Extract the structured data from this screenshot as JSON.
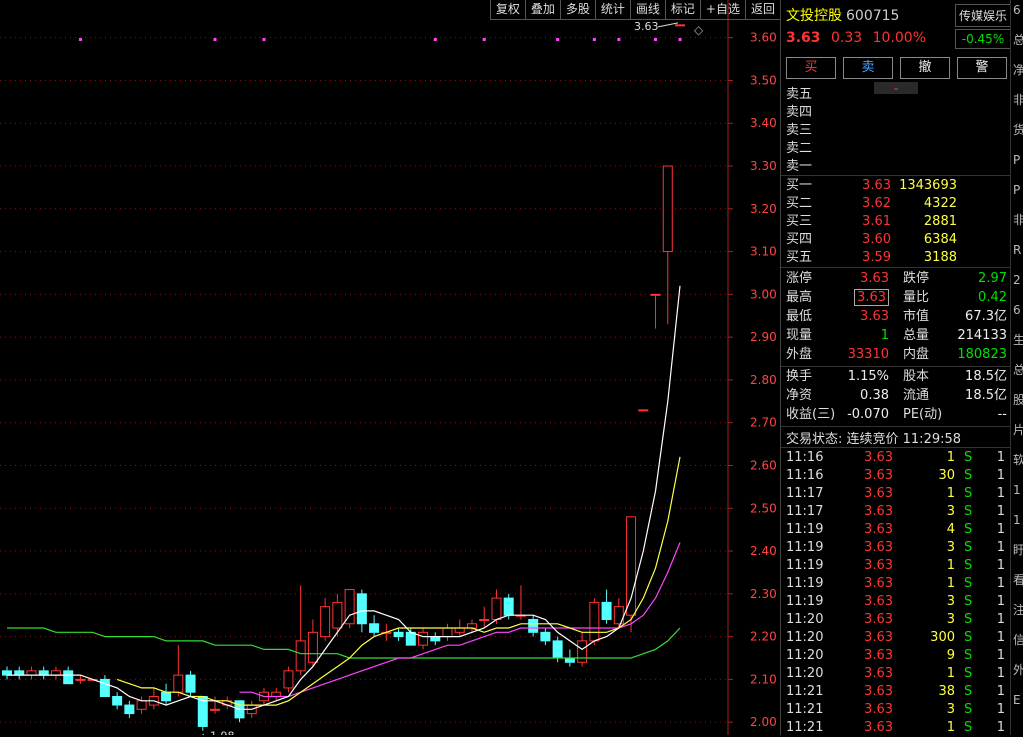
{
  "toolbar": [
    "复权",
    "叠加",
    "多股",
    "统计",
    "画线",
    "标记",
    "+自选",
    "返回"
  ],
  "stock": {
    "name": "文投控股",
    "code": "600715",
    "price": "3.63",
    "change": "0.33",
    "change_pct": "10.00%",
    "sector": "传媒娱乐",
    "sector_chg": "-0.45%"
  },
  "buttons": {
    "buy": "买",
    "sell": "卖",
    "cancel": "撤",
    "alert": "警"
  },
  "collapse_icon": "chevron-down-icon",
  "asks": [
    {
      "label": "卖五",
      "price": "",
      "vol": ""
    },
    {
      "label": "卖四",
      "price": "",
      "vol": ""
    },
    {
      "label": "卖三",
      "price": "",
      "vol": ""
    },
    {
      "label": "卖二",
      "price": "",
      "vol": ""
    },
    {
      "label": "卖一",
      "price": "",
      "vol": ""
    }
  ],
  "bids": [
    {
      "label": "买一",
      "price": "3.63",
      "vol": "1343693"
    },
    {
      "label": "买二",
      "price": "3.62",
      "vol": "4322"
    },
    {
      "label": "买三",
      "price": "3.61",
      "vol": "2881"
    },
    {
      "label": "买四",
      "price": "3.60",
      "vol": "6384"
    },
    {
      "label": "买五",
      "price": "3.59",
      "vol": "3188"
    }
  ],
  "stats1": [
    {
      "k1": "涨停",
      "v1": "3.63",
      "c1": "red",
      "k2": "跌停",
      "v2": "2.97",
      "c2": "green"
    },
    {
      "k1": "最高",
      "v1": "3.63",
      "c1": "red",
      "boxed": true,
      "k2": "量比",
      "v2": "0.42",
      "c2": "green"
    },
    {
      "k1": "最低",
      "v1": "3.63",
      "c1": "red",
      "k2": "市值",
      "v2": "67.3亿",
      "c2": "white"
    },
    {
      "k1": "现量",
      "v1": "1",
      "c1": "green",
      "k2": "总量",
      "v2": "214133",
      "c2": "white"
    },
    {
      "k1": "外盘",
      "v1": "33310",
      "c1": "red",
      "k2": "内盘",
      "v2": "180823",
      "c2": "green"
    }
  ],
  "stats2": [
    {
      "k1": "换手",
      "v1": "1.15%",
      "c1": "white",
      "k2": "股本",
      "v2": "18.5亿",
      "c2": "white"
    },
    {
      "k1": "净资",
      "v1": "0.38",
      "c1": "white",
      "k2": "流通",
      "v2": "18.5亿",
      "c2": "white"
    },
    {
      "k1": "收益(三)",
      "v1": "-0.070",
      "c1": "white",
      "k2": "PE(动)",
      "v2": "--",
      "c2": "white"
    }
  ],
  "trade_status": "交易状态: 连续竞价 11:29:58",
  "trades": [
    {
      "t": "11:16",
      "p": "3.63",
      "v": "1",
      "s": "S",
      "n": "1"
    },
    {
      "t": "11:16",
      "p": "3.63",
      "v": "30",
      "s": "S",
      "n": "1"
    },
    {
      "t": "11:17",
      "p": "3.63",
      "v": "1",
      "s": "S",
      "n": "1"
    },
    {
      "t": "11:17",
      "p": "3.63",
      "v": "3",
      "s": "S",
      "n": "1"
    },
    {
      "t": "11:19",
      "p": "3.63",
      "v": "4",
      "s": "S",
      "n": "1"
    },
    {
      "t": "11:19",
      "p": "3.63",
      "v": "3",
      "s": "S",
      "n": "1"
    },
    {
      "t": "11:19",
      "p": "3.63",
      "v": "1",
      "s": "S",
      "n": "1"
    },
    {
      "t": "11:19",
      "p": "3.63",
      "v": "1",
      "s": "S",
      "n": "1"
    },
    {
      "t": "11:19",
      "p": "3.63",
      "v": "3",
      "s": "S",
      "n": "1"
    },
    {
      "t": "11:20",
      "p": "3.63",
      "v": "3",
      "s": "S",
      "n": "1"
    },
    {
      "t": "11:20",
      "p": "3.63",
      "v": "300",
      "s": "S",
      "n": "1"
    },
    {
      "t": "11:20",
      "p": "3.63",
      "v": "9",
      "s": "S",
      "n": "1"
    },
    {
      "t": "11:20",
      "p": "3.63",
      "v": "1",
      "s": "S",
      "n": "1"
    },
    {
      "t": "11:21",
      "p": "3.63",
      "v": "38",
      "s": "S",
      "n": "1"
    },
    {
      "t": "11:21",
      "p": "3.63",
      "v": "3",
      "s": "S",
      "n": "1"
    },
    {
      "t": "11:21",
      "p": "3.63",
      "v": "1",
      "s": "S",
      "n": "1"
    }
  ],
  "right_strip": [
    "6",
    "总",
    "净",
    "非",
    "货",
    "P",
    "P",
    "非",
    "R",
    "2",
    "6",
    "生",
    "总",
    "股",
    "片",
    "软",
    "1",
    "1",
    "盱",
    "看",
    "注",
    "信",
    "外",
    "E"
  ],
  "chart_data": {
    "type": "candlestick",
    "y_ticks": [
      "3.60",
      "3.50",
      "3.40",
      "3.30",
      "3.20",
      "3.10",
      "3.00",
      "2.90",
      "2.80",
      "2.70",
      "2.60",
      "2.50",
      "2.40",
      "2.30",
      "2.20",
      "2.10",
      "2.00"
    ],
    "ylim": [
      1.97,
      3.66
    ],
    "annotations": {
      "high_label": "3.63",
      "low_label": "←1.98"
    },
    "colors": {
      "up": "#ff3333",
      "down": "#54ffff",
      "ma5": "#ffffff",
      "ma10": "#ffff44",
      "ma20": "#ff44ff",
      "ma60": "#33dd33",
      "grid": "#8a1010",
      "axis": "#aa2222"
    },
    "candles": [
      {
        "o": 2.12,
        "c": 2.11,
        "h": 2.13,
        "l": 2.1
      },
      {
        "o": 2.12,
        "c": 2.11,
        "h": 2.13,
        "l": 2.1
      },
      {
        "o": 2.11,
        "c": 2.12,
        "h": 2.13,
        "l": 2.1
      },
      {
        "o": 2.12,
        "c": 2.11,
        "h": 2.13,
        "l": 2.1
      },
      {
        "o": 2.11,
        "c": 2.12,
        "h": 2.13,
        "l": 2.1
      },
      {
        "o": 2.12,
        "c": 2.09,
        "h": 2.13,
        "l": 2.09
      },
      {
        "o": 2.1,
        "c": 2.1,
        "h": 2.11,
        "l": 2.09
      },
      {
        "o": 2.1,
        "c": 2.1,
        "h": 2.1,
        "l": 2.1
      },
      {
        "o": 2.1,
        "c": 2.06,
        "h": 2.11,
        "l": 2.06
      },
      {
        "o": 2.06,
        "c": 2.04,
        "h": 2.07,
        "l": 2.03
      },
      {
        "o": 2.04,
        "c": 2.02,
        "h": 2.05,
        "l": 2.01
      },
      {
        "o": 2.03,
        "c": 2.05,
        "h": 2.06,
        "l": 2.02
      },
      {
        "o": 2.04,
        "c": 2.06,
        "h": 2.08,
        "l": 2.03
      },
      {
        "o": 2.07,
        "c": 2.05,
        "h": 2.09,
        "l": 2.04
      },
      {
        "o": 2.07,
        "c": 2.11,
        "h": 2.18,
        "l": 2.06
      },
      {
        "o": 2.11,
        "c": 2.07,
        "h": 2.12,
        "l": 2.06
      },
      {
        "o": 2.06,
        "c": 1.99,
        "h": 2.06,
        "l": 1.98
      },
      {
        "o": 2.03,
        "c": 2.03,
        "h": 2.06,
        "l": 2.02
      },
      {
        "o": 2.04,
        "c": 2.05,
        "h": 2.06,
        "l": 2.03
      },
      {
        "o": 2.05,
        "c": 2.01,
        "h": 2.05,
        "l": 2.0
      },
      {
        "o": 2.02,
        "c": 2.04,
        "h": 2.05,
        "l": 2.01
      },
      {
        "o": 2.05,
        "c": 2.07,
        "h": 2.08,
        "l": 2.04
      },
      {
        "o": 2.06,
        "c": 2.07,
        "h": 2.08,
        "l": 2.05
      },
      {
        "o": 2.08,
        "c": 2.12,
        "h": 2.13,
        "l": 2.07
      },
      {
        "o": 2.12,
        "c": 2.19,
        "h": 2.32,
        "l": 2.11
      },
      {
        "o": 2.14,
        "c": 2.21,
        "h": 2.24,
        "l": 2.13
      },
      {
        "o": 2.2,
        "c": 2.27,
        "h": 2.29,
        "l": 2.19
      },
      {
        "o": 2.22,
        "c": 2.28,
        "h": 2.3,
        "l": 2.2
      },
      {
        "o": 2.23,
        "c": 2.31,
        "h": 2.31,
        "l": 2.22
      },
      {
        "o": 2.3,
        "c": 2.23,
        "h": 2.31,
        "l": 2.21
      },
      {
        "o": 2.23,
        "c": 2.21,
        "h": 2.25,
        "l": 2.2
      },
      {
        "o": 2.21,
        "c": 2.21,
        "h": 2.23,
        "l": 2.19
      },
      {
        "o": 2.21,
        "c": 2.2,
        "h": 2.22,
        "l": 2.19
      },
      {
        "o": 2.21,
        "c": 2.18,
        "h": 2.22,
        "l": 2.18
      },
      {
        "o": 2.18,
        "c": 2.21,
        "h": 2.22,
        "l": 2.17
      },
      {
        "o": 2.2,
        "c": 2.19,
        "h": 2.21,
        "l": 2.18
      },
      {
        "o": 2.2,
        "c": 2.22,
        "h": 2.23,
        "l": 2.19
      },
      {
        "o": 2.21,
        "c": 2.22,
        "h": 2.24,
        "l": 2.2
      },
      {
        "o": 2.22,
        "c": 2.23,
        "h": 2.24,
        "l": 2.21
      },
      {
        "o": 2.24,
        "c": 2.24,
        "h": 2.27,
        "l": 2.22
      },
      {
        "o": 2.24,
        "c": 2.29,
        "h": 2.31,
        "l": 2.23
      },
      {
        "o": 2.29,
        "c": 2.25,
        "h": 2.3,
        "l": 2.24
      },
      {
        "o": 2.25,
        "c": 2.25,
        "h": 2.32,
        "l": 2.24
      },
      {
        "o": 2.24,
        "c": 2.21,
        "h": 2.25,
        "l": 2.2
      },
      {
        "o": 2.21,
        "c": 2.19,
        "h": 2.22,
        "l": 2.18
      },
      {
        "o": 2.19,
        "c": 2.15,
        "h": 2.2,
        "l": 2.14
      },
      {
        "o": 2.15,
        "c": 2.14,
        "h": 2.17,
        "l": 2.13
      },
      {
        "o": 2.14,
        "c": 2.19,
        "h": 2.21,
        "l": 2.13
      },
      {
        "o": 2.19,
        "c": 2.28,
        "h": 2.29,
        "l": 2.18
      },
      {
        "o": 2.28,
        "c": 2.24,
        "h": 2.31,
        "l": 2.23
      },
      {
        "o": 2.23,
        "c": 2.27,
        "h": 2.29,
        "l": 2.22
      },
      {
        "o": 2.25,
        "c": 2.48,
        "h": 2.48,
        "l": 2.21
      },
      {
        "o": 2.73,
        "c": 2.73,
        "h": 2.73,
        "l": 2.73
      },
      {
        "o": 3.0,
        "c": 3.0,
        "h": 3.0,
        "l": 2.92
      },
      {
        "o": 3.1,
        "c": 3.3,
        "h": 3.3,
        "l": 2.93
      },
      {
        "o": 3.63,
        "c": 3.63,
        "h": 3.63,
        "l": 3.63
      }
    ],
    "ma": {
      "ma5": [
        2.11,
        2.11,
        2.11,
        2.11,
        2.11,
        2.11,
        2.11,
        2.1,
        2.09,
        2.08,
        2.06,
        2.05,
        2.05,
        2.04,
        2.05,
        2.06,
        2.05,
        2.05,
        2.04,
        2.03,
        2.03,
        2.04,
        2.05,
        2.06,
        2.1,
        2.13,
        2.17,
        2.21,
        2.25,
        2.26,
        2.26,
        2.25,
        2.24,
        2.21,
        2.2,
        2.2,
        2.2,
        2.2,
        2.21,
        2.22,
        2.24,
        2.25,
        2.25,
        2.25,
        2.24,
        2.21,
        2.19,
        2.17,
        2.19,
        2.2,
        2.22,
        2.29,
        2.4,
        2.54,
        2.75,
        3.02
      ],
      "ma10": [
        null,
        null,
        null,
        null,
        null,
        null,
        null,
        null,
        null,
        2.1,
        2.09,
        2.08,
        2.08,
        2.07,
        2.07,
        2.06,
        2.06,
        2.05,
        2.05,
        2.04,
        2.04,
        2.04,
        2.04,
        2.05,
        2.07,
        2.09,
        2.11,
        2.13,
        2.15,
        2.18,
        2.2,
        2.21,
        2.22,
        2.22,
        2.22,
        2.22,
        2.22,
        2.22,
        2.22,
        2.21,
        2.22,
        2.22,
        2.23,
        2.23,
        2.23,
        2.23,
        2.22,
        2.21,
        2.21,
        2.21,
        2.22,
        2.24,
        2.29,
        2.36,
        2.47,
        2.62
      ],
      "ma20": [
        null,
        null,
        null,
        null,
        null,
        null,
        null,
        null,
        null,
        null,
        null,
        null,
        null,
        null,
        null,
        null,
        null,
        null,
        null,
        2.07,
        2.07,
        2.06,
        2.06,
        2.06,
        2.07,
        2.08,
        2.09,
        2.1,
        2.11,
        2.12,
        2.13,
        2.14,
        2.15,
        2.15,
        2.16,
        2.17,
        2.18,
        2.18,
        2.19,
        2.2,
        2.21,
        2.21,
        2.22,
        2.22,
        2.22,
        2.22,
        2.22,
        2.22,
        2.22,
        2.22,
        2.22,
        2.23,
        2.25,
        2.29,
        2.35,
        2.42
      ],
      "ma60": [
        2.22,
        2.22,
        2.22,
        2.22,
        2.21,
        2.21,
        2.21,
        2.21,
        2.2,
        2.2,
        2.2,
        2.2,
        2.2,
        2.19,
        2.19,
        2.19,
        2.19,
        2.18,
        2.18,
        2.18,
        2.18,
        2.17,
        2.17,
        2.17,
        2.16,
        2.16,
        2.16,
        2.16,
        2.15,
        2.15,
        2.15,
        2.15,
        2.15,
        2.15,
        2.15,
        2.15,
        2.15,
        2.15,
        2.15,
        2.15,
        2.15,
        2.15,
        2.15,
        2.15,
        2.15,
        2.15,
        2.15,
        2.15,
        2.15,
        2.15,
        2.15,
        2.15,
        2.16,
        2.17,
        2.19,
        2.22
      ]
    },
    "markers": [
      9,
      28,
      34,
      57,
      62,
      73,
      78,
      81,
      85,
      88
    ]
  }
}
